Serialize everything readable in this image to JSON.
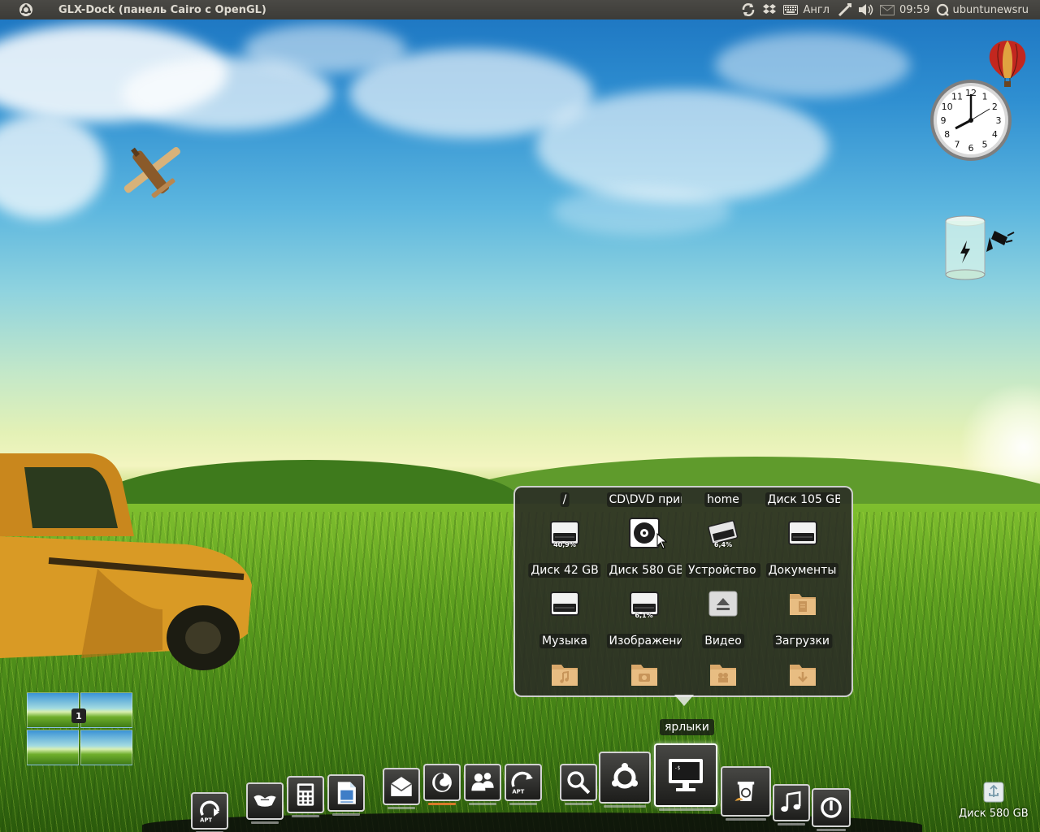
{
  "top_panel": {
    "window_title": "GLX-Dock (панель Cairo с OpenGL)",
    "keyboard_layout": "Англ",
    "time": "09:59",
    "username": "ubuntunewsru",
    "icons": [
      "ubuntu-logo-icon",
      "sync-icon",
      "dropbox-icon",
      "keyboard-icon",
      "network-icon",
      "volume-icon",
      "mail-icon",
      "session-icon"
    ]
  },
  "desktop": {
    "widgets": [
      "clock-widget",
      "balloon-widget",
      "battery-widget"
    ],
    "clock": {
      "hours_shown": [
        "12",
        "1",
        "2",
        "3",
        "4",
        "5",
        "6",
        "7",
        "8",
        "9",
        "10",
        "11"
      ]
    },
    "workspace_switcher": {
      "current": "1"
    },
    "desktop_disk_label": "Диск 580 GB"
  },
  "folder_popup": {
    "items": [
      {
        "label": "/",
        "icon": "drive-icon",
        "usage": "40,9%"
      },
      {
        "label": "CD\\DVD привод",
        "icon": "optical-drive-icon",
        "usage": ""
      },
      {
        "label": "home",
        "icon": "home-drive-icon",
        "usage": "6,4%"
      },
      {
        "label": "Диск 105 GB",
        "icon": "drive-icon",
        "usage": ""
      },
      {
        "label": "Диск 42 GB",
        "icon": "drive-icon",
        "usage": ""
      },
      {
        "label": "Диск 580 GB",
        "icon": "drive-icon",
        "usage": "6,1%"
      },
      {
        "label": "Устройство ч",
        "icon": "eject-icon",
        "usage": ""
      },
      {
        "label": "Документы",
        "icon": "documents-folder-icon",
        "usage": ""
      },
      {
        "label": "Музыка",
        "icon": "music-folder-icon",
        "usage": ""
      },
      {
        "label": "Изображени",
        "icon": "pictures-folder-icon",
        "usage": ""
      },
      {
        "label": "Видео",
        "icon": "video-folder-icon",
        "usage": ""
      },
      {
        "label": "Загрузки",
        "icon": "downloads-folder-icon",
        "usage": ""
      }
    ]
  },
  "dock": {
    "tooltip": "ярлыки",
    "items": [
      {
        "name": "apt-update-icon",
        "active": false
      },
      {
        "name": "thunderbird-icon",
        "active": false
      },
      {
        "name": "calculator-icon",
        "active": false
      },
      {
        "name": "writer-icon",
        "active": false
      },
      {
        "name": "mail-icon",
        "active": false
      },
      {
        "name": "firefox-icon",
        "active": false
      },
      {
        "name": "contacts-icon",
        "active": false
      },
      {
        "name": "apt-install-icon",
        "active": false
      },
      {
        "name": "search-icon",
        "active": false
      },
      {
        "name": "ubuntu-settings-icon",
        "active": false
      },
      {
        "name": "shortcuts-monitor-icon",
        "active": true
      },
      {
        "name": "trash-icon",
        "active": false
      },
      {
        "name": "music-player-icon",
        "active": false
      },
      {
        "name": "power-icon",
        "active": false
      }
    ]
  }
}
